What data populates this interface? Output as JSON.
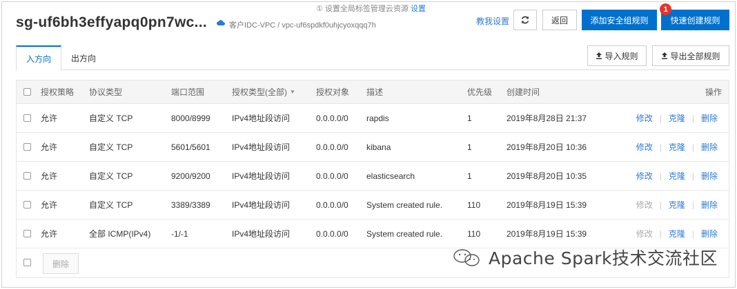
{
  "notice": {
    "text": "① 设置全局标签管理云资源",
    "link": "设置"
  },
  "header": {
    "sg_id": "sg-uf6bh3effyapq0pn7wc...",
    "vpc_text": "客户IDC-VPC / vpc-uf6spdkf0uhjcyoxqqq7h",
    "help_label": "教我设置",
    "refresh_icon": "refresh-icon",
    "back_label": "返回",
    "add_rule_label": "添加安全组规则",
    "quick_create_label": "快速创建规则",
    "badge_count": "1"
  },
  "tabs": [
    {
      "label": "入方向",
      "active": true
    },
    {
      "label": "出方向",
      "active": false
    }
  ],
  "toolbar": {
    "import_label": "导入规则",
    "export_label": "导出全部规则"
  },
  "table": {
    "headers": [
      "授权策略",
      "协议类型",
      "端口范围",
      "授权类型(全部)",
      "授权对象",
      "描述",
      "优先级",
      "创建时间",
      "操作"
    ],
    "sort_icon": "▼",
    "rows": [
      {
        "policy": "允许",
        "protocol": "自定义 TCP",
        "port": "8000/8999",
        "auth_type": "IPv4地址段访问",
        "object": "0.0.0.0/0",
        "desc": "rapdis",
        "priority": "1",
        "time": "2019年8月28日 21:37",
        "ops": [
          "修改",
          "克隆",
          "删除"
        ],
        "edit_disabled": false
      },
      {
        "policy": "允许",
        "protocol": "自定义 TCP",
        "port": "5601/5601",
        "auth_type": "IPv4地址段访问",
        "object": "0.0.0.0/0",
        "desc": "kibana",
        "priority": "1",
        "time": "2019年8月20日 10:36",
        "ops": [
          "修改",
          "克隆",
          "删除"
        ],
        "edit_disabled": false
      },
      {
        "policy": "允许",
        "protocol": "自定义 TCP",
        "port": "9200/9200",
        "auth_type": "IPv4地址段访问",
        "object": "0.0.0.0/0",
        "desc": "elasticsearch",
        "priority": "1",
        "time": "2019年8月20日 10:35",
        "ops": [
          "修改",
          "克隆",
          "删除"
        ],
        "edit_disabled": false
      },
      {
        "policy": "允许",
        "protocol": "自定义 TCP",
        "port": "3389/3389",
        "auth_type": "IPv4地址段访问",
        "object": "0.0.0.0/0",
        "desc": "System created rule.",
        "priority": "110",
        "time": "2019年8月19日 15:39",
        "ops": [
          "修改",
          "克隆",
          "删除"
        ],
        "edit_disabled": true
      },
      {
        "policy": "允许",
        "protocol": "全部 ICMP(IPv4)",
        "port": "-1/-1",
        "auth_type": "IPv4地址段访问",
        "object": "0.0.0.0/0",
        "desc": "System created rule.",
        "priority": "110",
        "time": "2019年8月19日 15:39",
        "ops": [
          "修改",
          "克隆",
          "删除"
        ],
        "edit_disabled": true
      }
    ],
    "bulk_delete_label": "删除"
  },
  "watermark": {
    "text": "Apache Spark技术交流社区"
  },
  "colors": {
    "primary": "#0070cc",
    "link": "#2d7ad6",
    "badge": "#e5352c"
  }
}
